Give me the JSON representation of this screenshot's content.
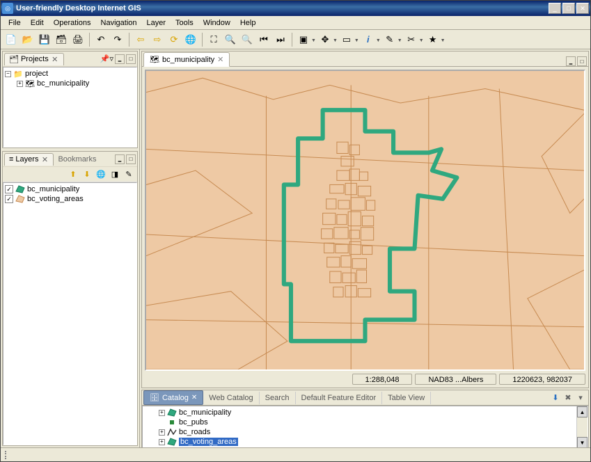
{
  "window": {
    "title": "User-friendly Desktop Internet GIS"
  },
  "menubar": [
    "File",
    "Edit",
    "Operations",
    "Navigation",
    "Layer",
    "Tools",
    "Window",
    "Help"
  ],
  "toolbar": {
    "groups": [
      [
        "new-doc",
        "open-doc",
        "save-doc",
        "save-all",
        "print"
      ],
      [
        "undo",
        "redo"
      ],
      [
        "back-arrow",
        "forward-arrow",
        "refresh",
        "world"
      ],
      [
        "zoom-extent",
        "zoom-in",
        "zoom-out",
        "zoom-prev",
        "zoom-next"
      ],
      [
        "layer-dd",
        "pan-dd",
        "select-dd",
        "info-dd",
        "measure-dd",
        "edit-dd",
        "catalog-dd"
      ]
    ]
  },
  "projects": {
    "title": "Projects",
    "tree": {
      "root": "project",
      "child": "bc_municipality"
    }
  },
  "layers": {
    "title": "Layers",
    "bookmarks": "Bookmarks",
    "items": [
      {
        "name": "bc_municipality",
        "checked": true,
        "color": "#2fa87f"
      },
      {
        "name": "bc_voting_areas",
        "checked": true,
        "color": "#e6b88a"
      }
    ]
  },
  "map": {
    "tab": "bc_municipality",
    "scale": "1:288,048",
    "crs": "NAD83 ...Albers",
    "coords": "1220623, 982037"
  },
  "catalog": {
    "tabs": [
      "Catalog",
      "Web Catalog",
      "Search",
      "Default Feature Editor",
      "Table View"
    ],
    "active": 0,
    "items": [
      {
        "name": "bc_municipality",
        "icon": "poly-green"
      },
      {
        "name": "bc_pubs",
        "icon": "point"
      },
      {
        "name": "bc_roads",
        "icon": "line"
      },
      {
        "name": "bc_voting_areas",
        "icon": "poly-green",
        "selected": true
      }
    ]
  }
}
